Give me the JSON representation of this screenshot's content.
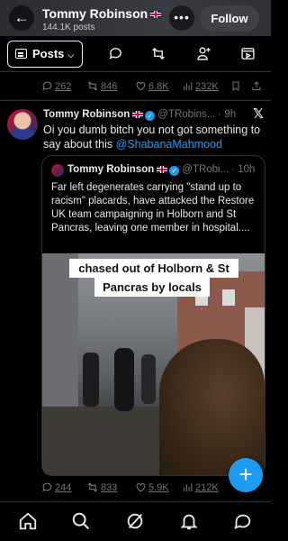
{
  "header": {
    "name": "Tommy Robinson",
    "post_count": "144.1K posts",
    "follow_label": "Follow",
    "more_label": "•••",
    "back_icon": "back-arrow-icon"
  },
  "toolbar": {
    "posts_label": "Posts",
    "icons": [
      "reply-icon",
      "repost-icon",
      "add-user-icon",
      "video-icon"
    ]
  },
  "prev_stats": {
    "replies": "262",
    "reposts": "846",
    "likes": "6.8K",
    "views": "232K"
  },
  "tweet": {
    "author": "Tommy Robinson",
    "handle": "@TRobins...",
    "time": "· 9h",
    "text": "Oi you dumb bitch you not got something to say about this ",
    "mention": "@ShabanaMahmood",
    "stats": {
      "replies": "244",
      "reposts": "833",
      "likes": "5.9K",
      "views": "212K"
    }
  },
  "quote": {
    "author": "Tommy Robinson",
    "handle": "@TRobi...",
    "time": "· 10h",
    "text": "Far left degenerates carrying \"stand up to racism\" placards, have attacked the Restore UK team campaigning in Holborn and St Pancras, leaving one member in hospital....",
    "caption_line1": "chased out of Holborn & St",
    "caption_line2": "Pancras by locals"
  },
  "colors": {
    "accent": "#1d9bf0",
    "background": "#000000",
    "muted_text": "#71767b",
    "border": "#2f3336"
  }
}
